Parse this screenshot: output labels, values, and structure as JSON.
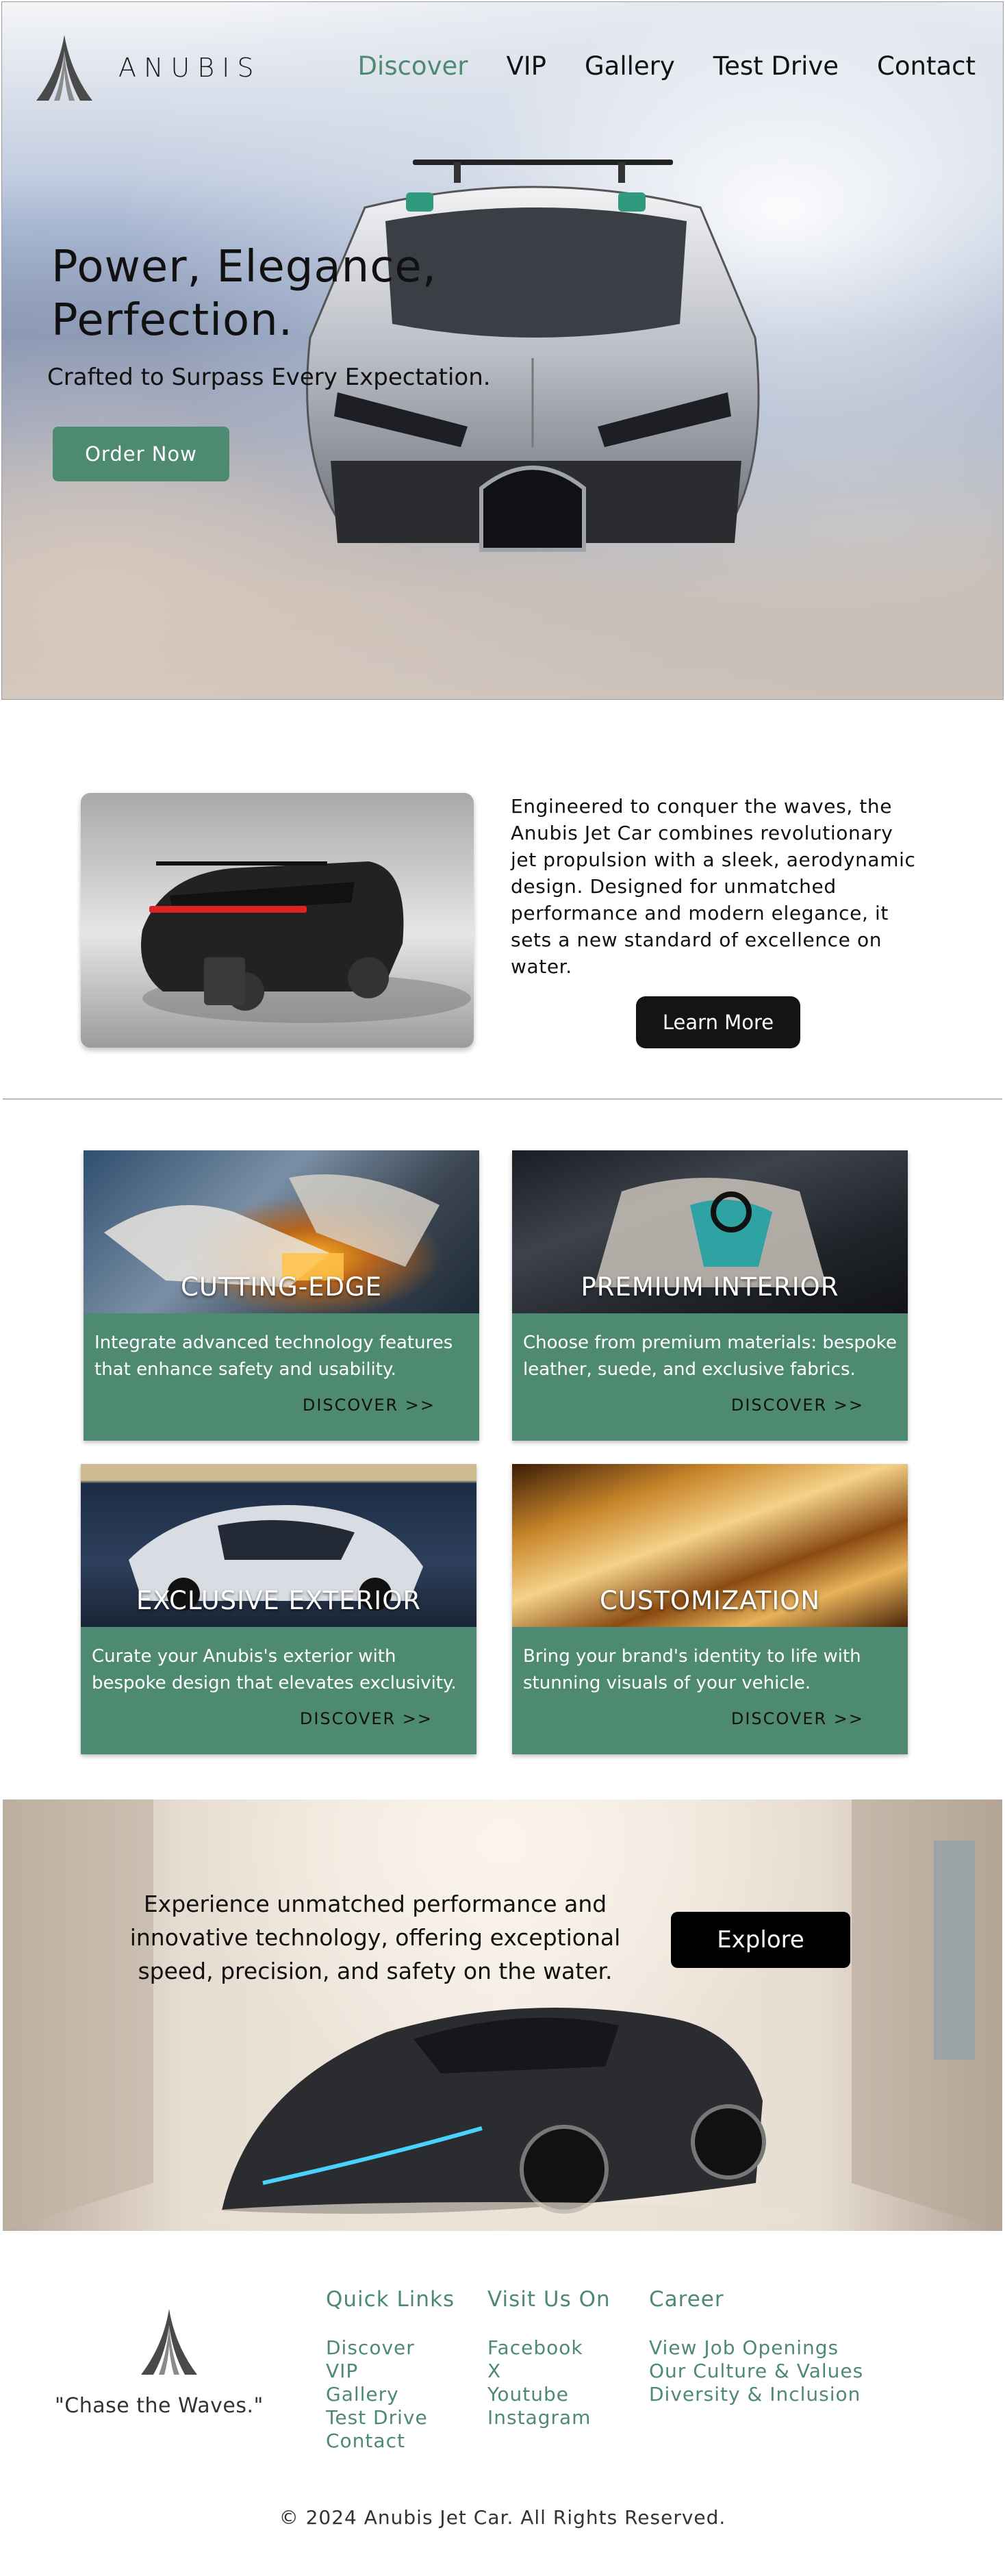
{
  "brand": {
    "name": "ANUBIS"
  },
  "nav": {
    "items": [
      "Discover",
      "VIP",
      "Gallery",
      "Test Drive",
      "Contact"
    ],
    "active": "Discover"
  },
  "hero": {
    "title_line1": "Power, Elegance,",
    "title_line2": "Perfection.",
    "subtitle": "Crafted to Surpass Every Expectation.",
    "cta": "Order Now"
  },
  "about": {
    "text": "Engineered to conquer the waves, the Anubis Jet Car combines revolutionary jet propulsion with a sleek, aerodynamic design. Designed for unmatched performance and modern elegance, it sets a new standard of excellence on water.",
    "cta": "Learn More"
  },
  "features": [
    {
      "title": "CUTTING-EDGE",
      "desc": "Integrate advanced technology features that enhance safety and usability.",
      "link": "DISCOVER >>"
    },
    {
      "title": "PREMIUM INTERIOR",
      "desc": "Choose from premium materials: bespoke leather, suede, and exclusive fabrics.",
      "link": "DISCOVER >>"
    },
    {
      "title": "EXCLUSIVE EXTERIOR",
      "desc": "Curate your Anubis's exterior with bespoke design that elevates exclusivity.",
      "link": "DISCOVER >>"
    },
    {
      "title": "CUSTOMIZATION",
      "desc": "Bring your brand's identity to life with stunning visuals of your vehicle.",
      "link": "DISCOVER >>"
    }
  ],
  "showcase": {
    "text": "Experience unmatched performance and innovative technology, offering exceptional speed, precision, and safety on the water.",
    "cta": "Explore"
  },
  "footer": {
    "slogan": "\"Chase the Waves.\"",
    "quick_links": {
      "heading": "Quick Links",
      "items": [
        "Discover",
        "VIP",
        "Gallery",
        "Test Drive",
        "Contact"
      ]
    },
    "visit": {
      "heading": "Visit Us On",
      "items": [
        "Facebook",
        "X",
        "Youtube",
        "Instagram"
      ]
    },
    "career": {
      "heading": "Career",
      "items": [
        "View Job Openings",
        "Our Culture & Values",
        "Diversity & Inclusion"
      ]
    },
    "copyright": "© 2024 Anubis Jet Car. All Rights Reserved."
  },
  "colors": {
    "accent": "#4e8a72",
    "dark": "#141414"
  },
  "icons": {
    "logo": "anubis-logo-icon"
  }
}
